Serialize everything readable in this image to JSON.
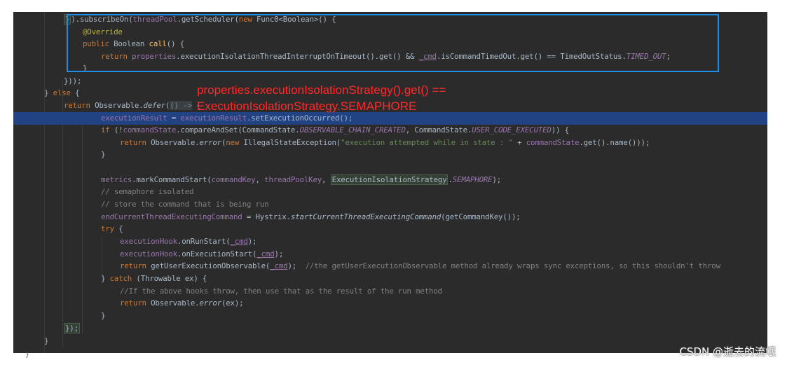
{
  "code": {
    "l1_close": "}",
    "l1_subscribe": ").subscribeOn(",
    "l1_threadpool": "threadPool",
    "l1_getsched": ".getScheduler(",
    "l1_new": "new",
    "l1_func": " Func0<Boolean>() {",
    "l2_override": "@Override",
    "l3_public": "public",
    "l3_boolean": " Boolean ",
    "l3_call": "call",
    "l3_rest": "() {",
    "l4_return": "return",
    "l4_properties": "properties",
    "l4_mid": ".executionIsolationThreadInterruptOnTimeout().get() && ",
    "l4_cmd": "_cmd",
    "l4_mid2": ".isCommandTimedOut.get() == TimedOutStatus.",
    "l4_timed": "TIMED_OUT",
    "l4_end": ";",
    "l5": "}",
    "l6": "}));",
    "l7_brace": "} ",
    "l7_else": "else",
    "l7_rest": " {",
    "l8_return": "return",
    "l8_obs": " Observable.",
    "l8_defer": "defer",
    "l8_paren": "(",
    "l8_lambda": "() ->",
    "l8_arrow": " {",
    "l9_result": "executionResult",
    "l9_eq": " = ",
    "l9_result2": "executionResult",
    "l9_method": ".setExecutionOccurred();",
    "l10_if": "if",
    "l10_a": " (!",
    "l10_state": "commandState",
    "l10_b": ".compareAndSet(CommandState.",
    "l10_chain": "OBSERVABLE_CHAIN_CREATED",
    "l10_c": ", CommandState.",
    "l10_user": "USER_CODE_EXECUTED",
    "l10_d": ")) {",
    "l11_return": "return",
    "l11_obs": " Observable.",
    "l11_error": "error",
    "l11_paren": "(",
    "l11_new": "new",
    "l11_ex": " IllegalStateException(",
    "l11_str": "\"execution attempted while in state : \"",
    "l11_plus": " + ",
    "l11_state": "commandState",
    "l11_end": ".get().name()));",
    "l12": "}",
    "l14_metrics": "metrics",
    "l14_mark": ".markCommandStart(",
    "l14_key": "commandKey",
    "l14_comma": ", ",
    "l14_tpkey": "threadPoolKey",
    "l14_comma2": ", ",
    "l14_strategy": "ExecutionIsolationStrategy",
    "l14_dot": ".",
    "l14_sem": "SEMAPHORE",
    "l14_end": ");",
    "l15": "// semaphore isolated",
    "l16": "// store the command that is being run",
    "l17_field": "endCurrentThreadExecutingCommand",
    "l17_eq": " = Hystrix.",
    "l17_start": "startCurrentThreadExecutingCommand",
    "l17_end": "(getCommandKey());",
    "l18_try": "try",
    "l18_rest": " {",
    "l19_hook": "executionHook",
    "l19_m": ".onRunStart(",
    "l19_cmd": "_cmd",
    "l19_end": ");",
    "l20_hook": "executionHook",
    "l20_m": ".onExecutionStart(",
    "l20_cmd": "_cmd",
    "l20_end": ");",
    "l21_return": "return",
    "l21_m": " getUserExecutionObservable(",
    "l21_cmd": "_cmd",
    "l21_end": ");  ",
    "l21_comment": "//the getUserExecutionObservable method already wraps sync exceptions, so this shouldn't throw",
    "l22_brace": "} ",
    "l22_catch": "catch",
    "l22_rest": " (Throwable ex) {",
    "l23": "//If the above hooks throw, then use that as the result of the run method",
    "l24_return": "return",
    "l24_obs": " Observable.",
    "l24_error": "error",
    "l24_end": "(ex);",
    "l25": "}",
    "l26": "});",
    "l27": "}",
    "l28": "}"
  },
  "annotation": {
    "line1": "properties.executionIsolationStrategy().get() ==",
    "line2": "ExecutionIsolationStrategy.SEMAPHORE"
  },
  "watermark": "CSDN @逝去的流氓",
  "colors": {
    "background": "#2b2b2b",
    "keyword": "#cc7832",
    "string": "#6a8759",
    "comment": "#808080",
    "field": "#9876aa",
    "highlight_box": "#1e8fe6",
    "annotation_text": "#ff2a2a"
  }
}
